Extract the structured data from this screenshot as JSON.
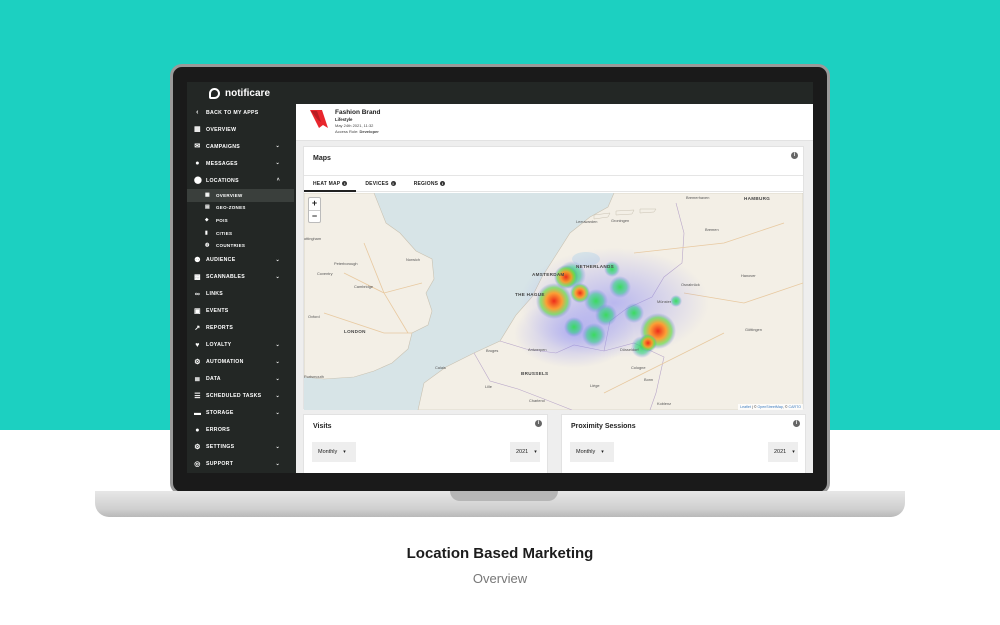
{
  "app": {
    "brand": "notificare"
  },
  "sidebar": {
    "back": "BACK TO MY APPS",
    "items": [
      {
        "label": "OVERVIEW"
      },
      {
        "label": "CAMPAIGNS"
      },
      {
        "label": "MESSAGES"
      },
      {
        "label": "LOCATIONS"
      },
      {
        "label": "AUDIENCE"
      },
      {
        "label": "SCANNABLES"
      },
      {
        "label": "LINKS"
      },
      {
        "label": "EVENTS"
      },
      {
        "label": "REPORTS"
      },
      {
        "label": "LOYALTY"
      },
      {
        "label": "AUTOMATION"
      },
      {
        "label": "DATA"
      },
      {
        "label": "SCHEDULED TASKS"
      },
      {
        "label": "STORAGE"
      },
      {
        "label": "ERRORS"
      },
      {
        "label": "SETTINGS"
      },
      {
        "label": "SUPPORT"
      }
    ],
    "locations_sub": [
      {
        "label": "OVERVIEW"
      },
      {
        "label": "GEO-ZONES"
      },
      {
        "label": "POIS"
      },
      {
        "label": "CITIES"
      },
      {
        "label": "COUNTRIES"
      }
    ]
  },
  "header": {
    "app_name": "Fashion Brand",
    "category": "Lifestyle",
    "date": "May 24th 2021, 11:32",
    "role_label": "Access Role:",
    "role_value": "Developer"
  },
  "maps": {
    "title": "Maps",
    "tabs": [
      "HEAT MAP",
      "DEVICES",
      "REGIONS"
    ],
    "active_tab": "HEAT MAP",
    "zoom_in": "+",
    "zoom_out": "−",
    "attribution_leaflet": "Leaflet",
    "attribution_osm": "OpenStreetMap",
    "attribution_carto": "CARTO",
    "labels": {
      "nottingham": "ottingham",
      "peterborough": "Peterborough",
      "norwich": "Norwich",
      "coventry": "Coventry",
      "cambridge": "Cambridge",
      "oxford": "Oxford",
      "london": "LONDON",
      "portsmouth": "Portsmouth",
      "calais": "Calais",
      "lille": "Lille",
      "bruges": "Bruges",
      "antwerp": "Antwerpen",
      "brussels": "BRUSSELS",
      "charleroi": "Charleroi",
      "amsterdam": "AMSTERDAM",
      "thehague": "THE HAGUE",
      "netherlands": "NETHERLANDS",
      "leeuwarden": "Leeuwarden",
      "groningen": "Groningen",
      "bremerhaven": "Bremerhaven",
      "hamburg": "HAMBURG",
      "bremen": "Bremen",
      "hanover": "Hanover",
      "osnabruck": "Osnabrück",
      "munster": "Münster",
      "gottingen": "Göttingen",
      "dusseldorf": "Düsseldorf",
      "cologne": "Cologne",
      "bonn": "Bonn",
      "koblenz": "Koblenz",
      "liege": "Liège"
    }
  },
  "visits": {
    "title": "Visits",
    "period": "Monthly",
    "year": "2021"
  },
  "proximity": {
    "title": "Proximity Sessions",
    "period": "Monthly",
    "year": "2021"
  },
  "caption": {
    "title": "Location Based Marketing",
    "subtitle": "Overview"
  },
  "colors": {
    "background": "#1cd0c1",
    "sidebar": "#232725",
    "heat_low": "#7b7bf0",
    "heat_mid": "#33dd55",
    "heat_high": "#ee3322"
  }
}
